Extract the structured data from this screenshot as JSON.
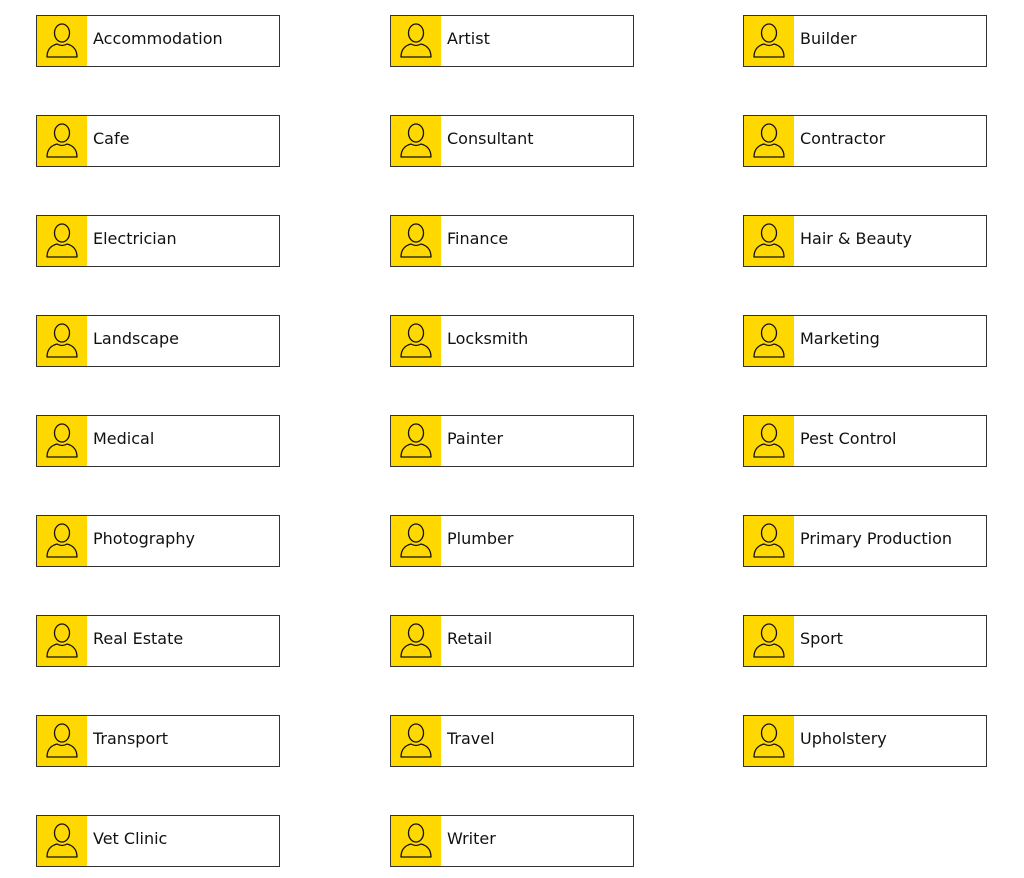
{
  "accent_color": "#FFD800",
  "icon": "user-icon",
  "categories": [
    "Accommodation",
    "Artist",
    "Builder",
    "Cafe",
    "Consultant",
    "Contractor",
    "Electrician",
    "Finance",
    "Hair & Beauty",
    "Landscape",
    "Locksmith",
    "Marketing",
    "Medical",
    "Painter",
    "Pest Control",
    "Photography",
    "Plumber",
    "Primary Production",
    "Real Estate",
    "Retail",
    "Sport",
    "Transport",
    "Travel",
    "Upholstery",
    "Vet Clinic",
    "Writer"
  ]
}
